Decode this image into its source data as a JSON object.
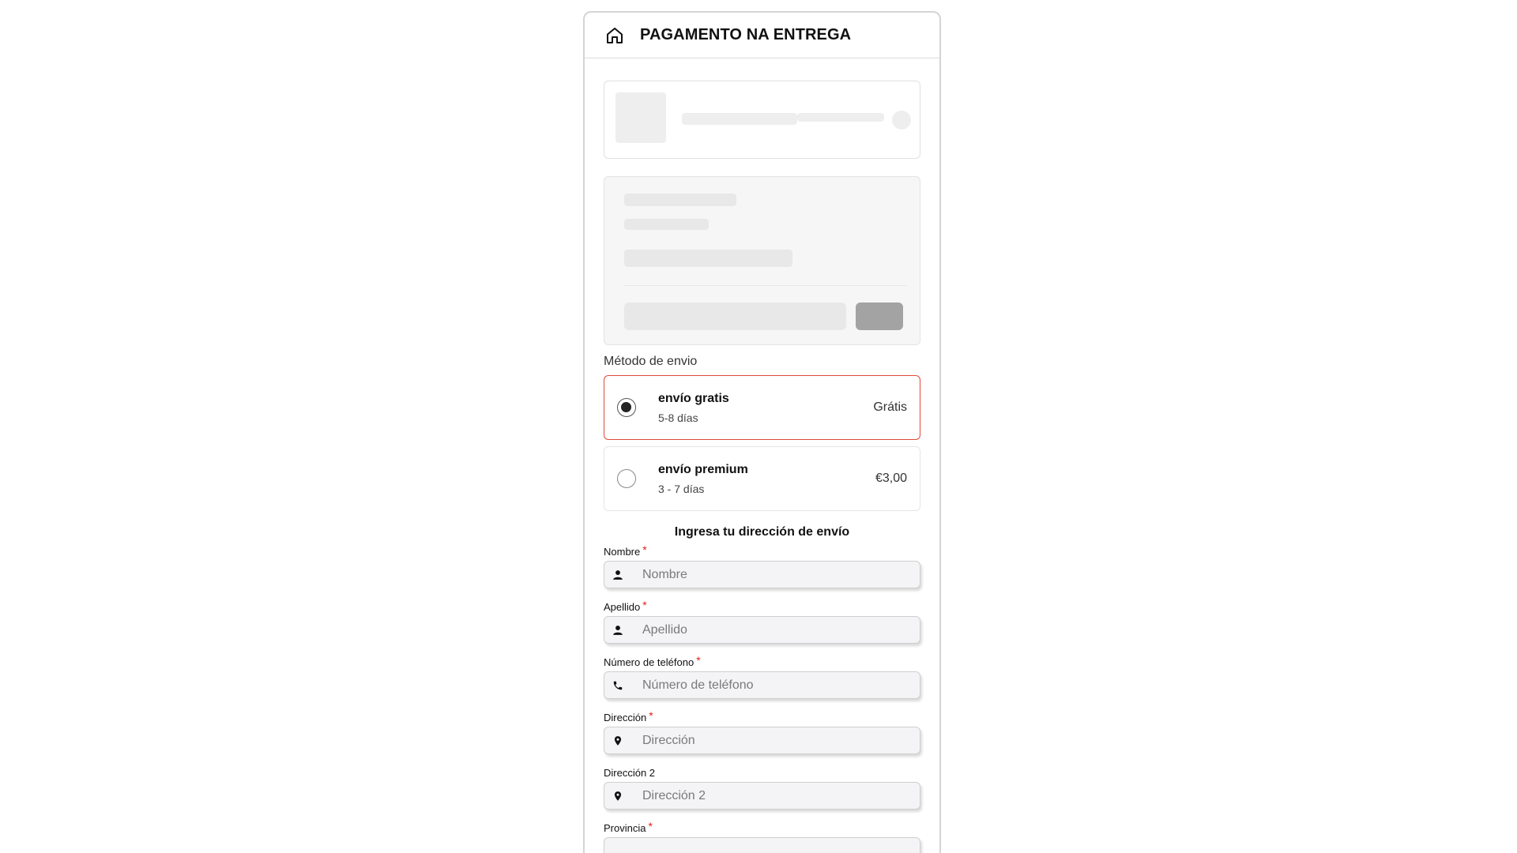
{
  "header": {
    "title": "PAGAMENTO NA ENTREGA",
    "icon": "home-icon"
  },
  "shipping": {
    "label": "Método de envio",
    "options": [
      {
        "name": "envío gratis",
        "eta": "5-8 días",
        "price": "Grátis",
        "selected": true
      },
      {
        "name": "envío premium",
        "eta": "3 - 7 días",
        "price": "€3,00",
        "selected": false
      }
    ],
    "selected_color": "#e04a3a"
  },
  "form": {
    "title": "Ingresa tu dirección de envío",
    "required_mark": "*",
    "fields": [
      {
        "label": "Nombre",
        "placeholder": "Nombre",
        "icon": "person-icon",
        "required": true
      },
      {
        "label": "Apellido",
        "placeholder": "Apellido",
        "icon": "person-icon",
        "required": true
      },
      {
        "label": "Número de teléfono",
        "placeholder": "Número de teléfono",
        "icon": "phone-icon",
        "required": true
      },
      {
        "label": "Dirección",
        "placeholder": "Dirección",
        "icon": "location-pin-icon",
        "required": true
      },
      {
        "label": "Dirección 2",
        "placeholder": "Dirección 2",
        "icon": "location-pin-icon",
        "required": false
      },
      {
        "label": "Provincia",
        "placeholder": "",
        "icon": "",
        "required": true
      }
    ]
  }
}
